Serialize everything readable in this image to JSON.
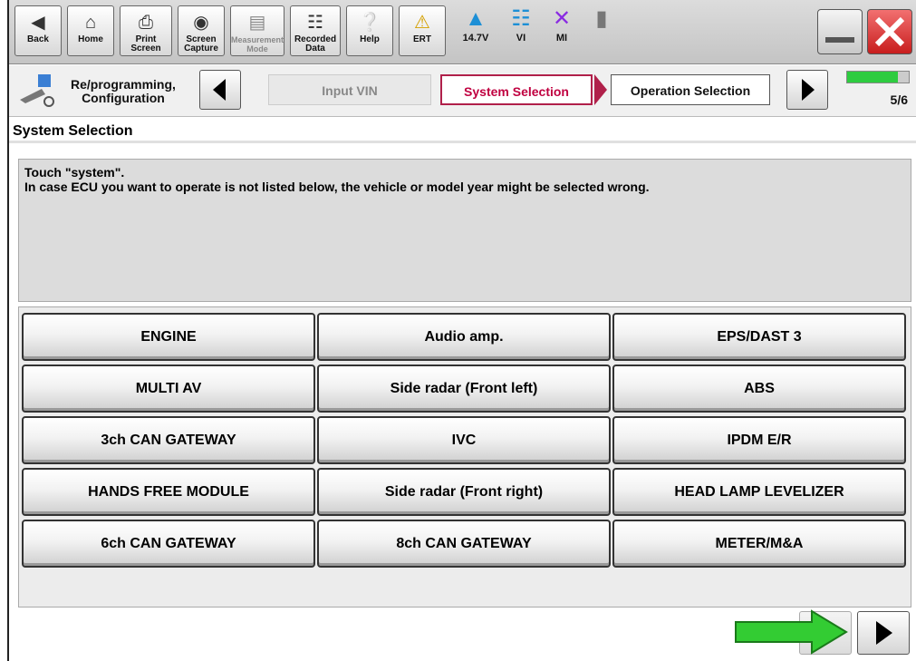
{
  "toolbar": {
    "back": "Back",
    "home": "Home",
    "print_screen": "Print Screen",
    "screen_capture": "Screen Capture",
    "measurement_mode": "Measurement Mode",
    "recorded_data": "Recorded Data",
    "help": "Help",
    "ert": "ERT",
    "voltage": "14.7V",
    "vi": "VI",
    "mi": "MI"
  },
  "navigation": {
    "mode_line1": "Re/programming,",
    "mode_line2": "Configuration",
    "steps": [
      {
        "label": "Input VIN",
        "state": "inactive"
      },
      {
        "label": "System Selection",
        "state": "active"
      },
      {
        "label": "Operation Selection",
        "state": "next"
      }
    ],
    "progress_text": "5/6",
    "progress_fraction": 0.83
  },
  "section_title": "System Selection",
  "message": {
    "line1": "Touch \"system\".",
    "line2": "In case ECU you want to operate is not listed below, the vehicle or model year might be selected wrong."
  },
  "systems": [
    "ENGINE",
    "Audio amp.",
    "EPS/DAST 3",
    "MULTI AV",
    "Side radar (Front left)",
    "ABS",
    "3ch CAN GATEWAY",
    "IVC",
    "IPDM E/R",
    "HANDS FREE MODULE",
    "Side radar (Front right)",
    "HEAD LAMP LEVELIZER",
    "6ch CAN GATEWAY",
    "8ch CAN GATEWAY",
    "METER/M&A"
  ],
  "colors": {
    "active_step": "#c00040",
    "progress_fill": "#2ecc40",
    "close_button": "#e03030",
    "annotation_arrow": "#33cc33"
  },
  "icons": {
    "back": "back-arrow-icon",
    "home": "home-icon",
    "print": "printer-icon",
    "capture": "camera-icon",
    "measure": "measurement-icon",
    "recorded": "recorded-data-icon",
    "help": "question-icon",
    "ert": "warning-icon",
    "battery": "car-battery-icon",
    "vi": "signal-icon",
    "mi": "mi-x-icon",
    "minimize": "minimize-icon",
    "close": "close-icon"
  }
}
